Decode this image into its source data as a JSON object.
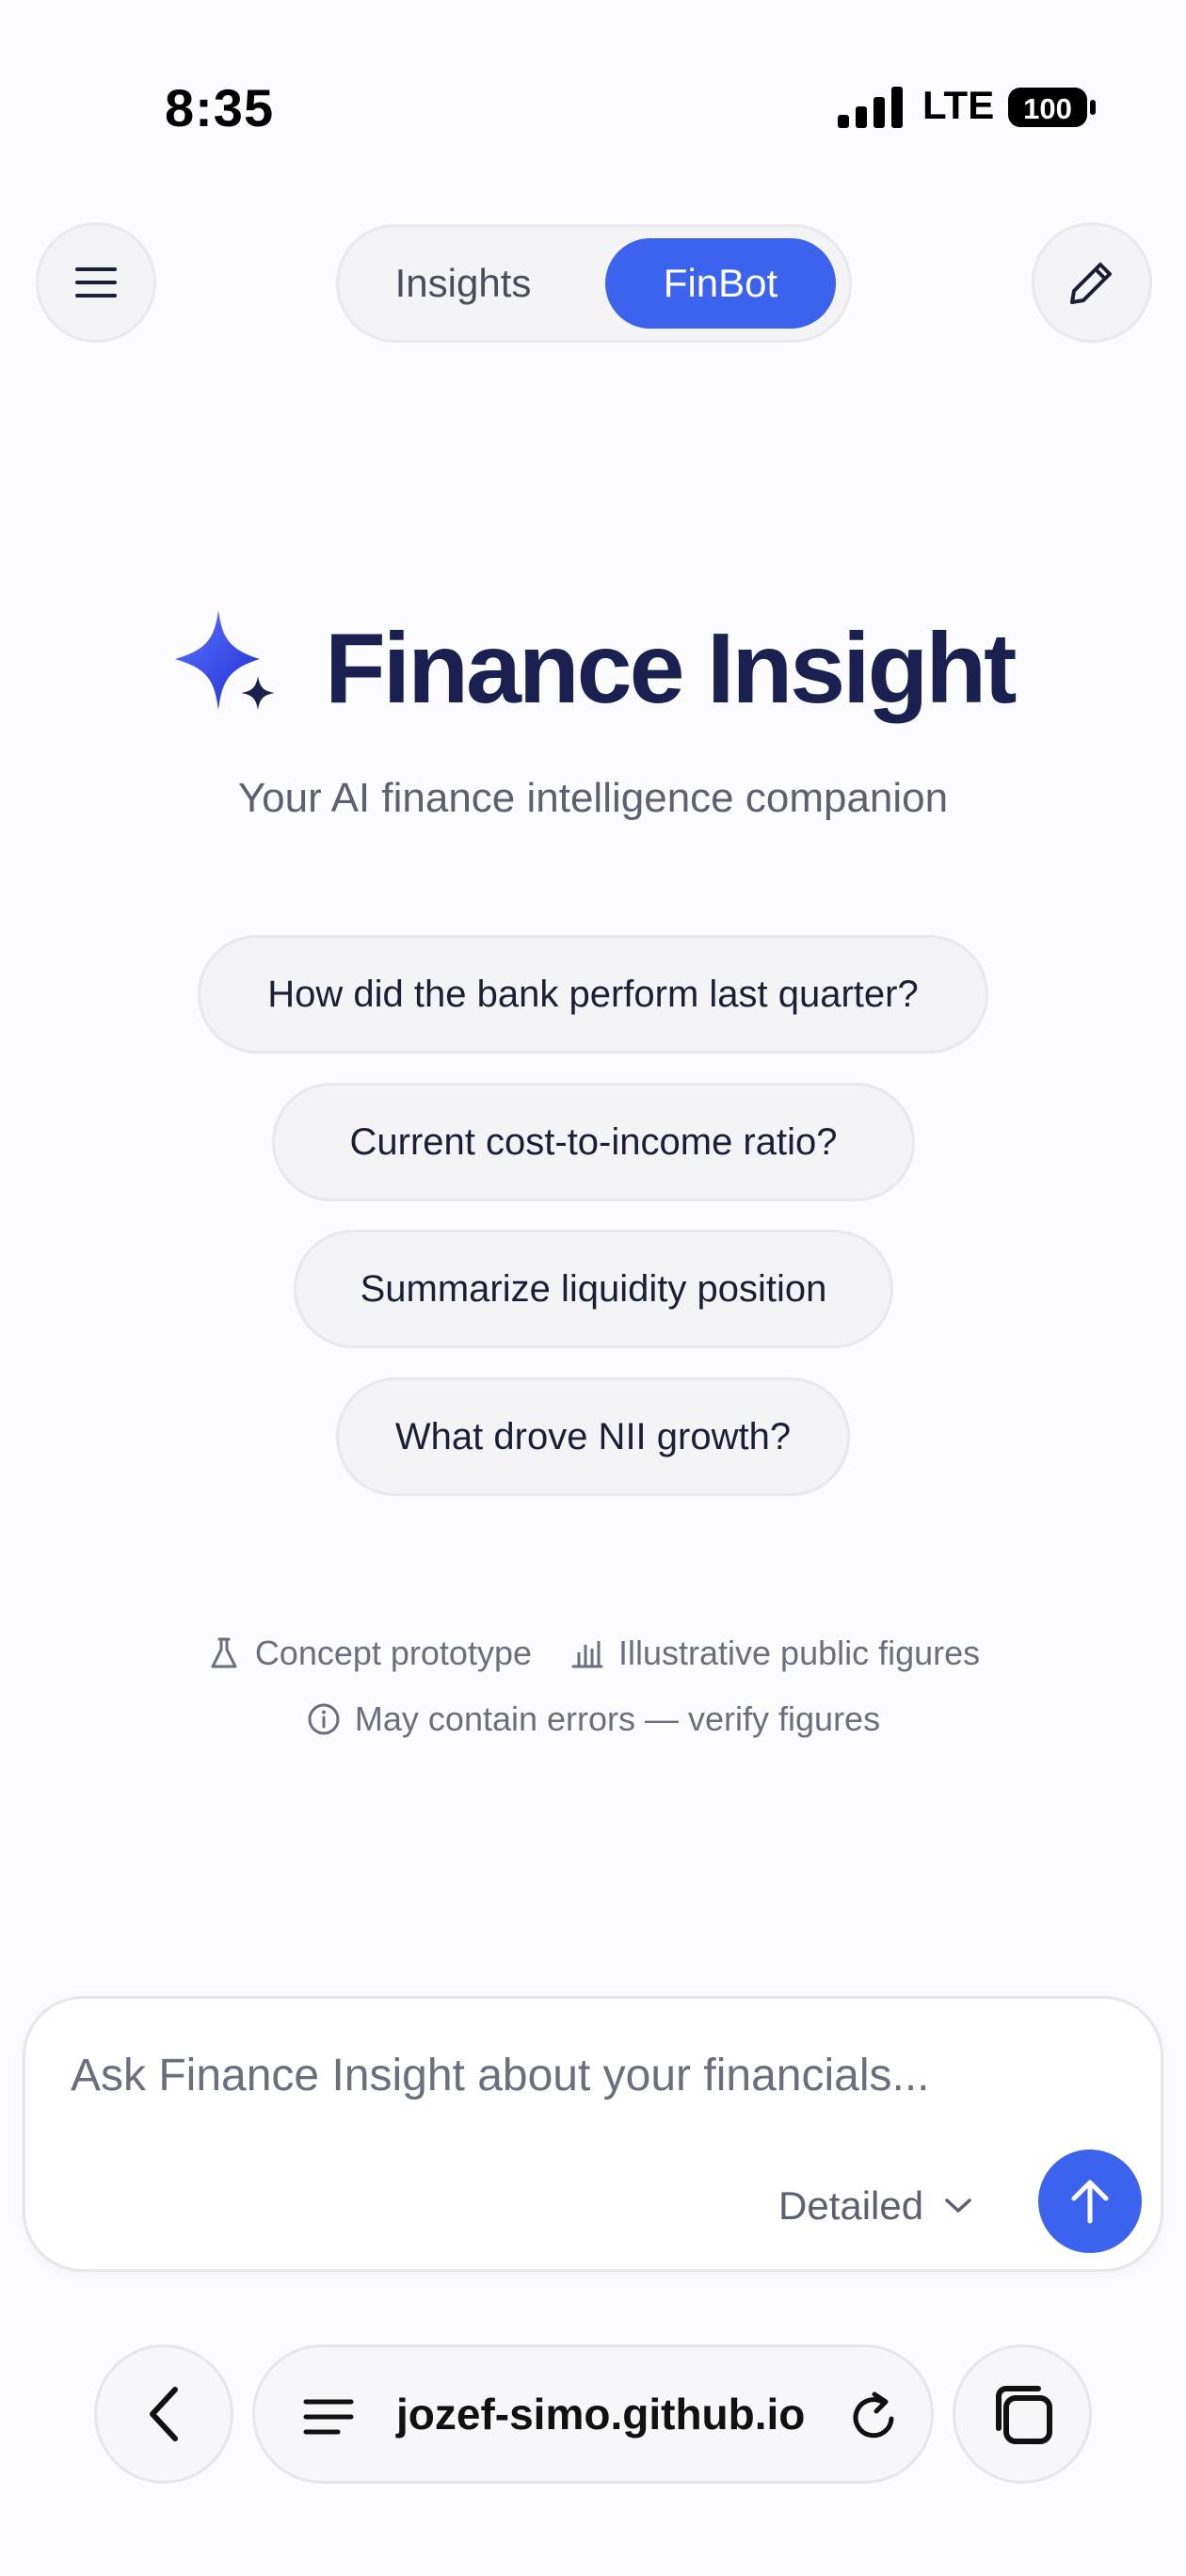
{
  "status_bar": {
    "time": "8:35",
    "network": "LTE",
    "battery": "100"
  },
  "header": {
    "menu_icon": "hamburger-menu-icon",
    "edit_icon": "pencil-icon",
    "tabs": [
      {
        "label": "Insights",
        "active": false
      },
      {
        "label": "FinBot",
        "active": true
      }
    ]
  },
  "hero": {
    "icon": "sparkle-icon",
    "title": "Finance Insight",
    "subtitle": "Your AI finance intelligence companion"
  },
  "suggestions": [
    "How did the bank perform last quarter?",
    "Current cost-to-income ratio?",
    "Summarize liquidity position",
    "What drove NII growth?"
  ],
  "disclaimer": {
    "items": [
      {
        "icon": "flask-icon",
        "label": "Concept prototype"
      },
      {
        "icon": "bar-chart-icon",
        "label": "Illustrative public figures"
      },
      {
        "icon": "info-icon",
        "label": "May contain errors — verify figures"
      }
    ]
  },
  "composer": {
    "placeholder": "Ask Finance Insight about your financials...",
    "value": "",
    "mode": "Detailed",
    "send_icon": "arrow-up-icon"
  },
  "browser": {
    "url": "jozef-simo.github.io",
    "back_icon": "chevron-left-icon",
    "reader_icon": "reader-lines-icon",
    "reload_icon": "reload-icon",
    "tabs_icon": "tabs-icon"
  },
  "colors": {
    "accent": "#3c63ee",
    "title": "#1a2150",
    "background": "#fcfcfe"
  }
}
